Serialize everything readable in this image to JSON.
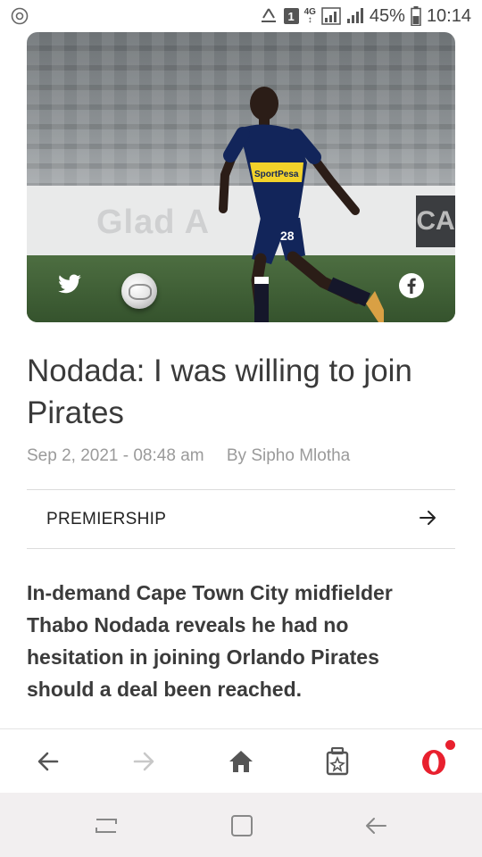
{
  "status_bar": {
    "sim_slot": "1",
    "network": "4G",
    "battery": "45%",
    "time": "10:14"
  },
  "hero": {
    "board_text": "Glad A",
    "board_dark_text": "CA",
    "jersey_sponsor": "SportPesa",
    "jersey_number": "28",
    "icons": [
      "twitter-icon",
      "facebook-icon"
    ]
  },
  "article": {
    "title": "Nodada: I was willing to join Pirates",
    "date": "Sep 2, 2021 - 08:48 am",
    "author": "By Sipho Mlotha",
    "category": "PREMIERSHIP",
    "lead": "In-demand Cape Town City midfielder Thabo Nodada reveals he had no hesitation in joining Orlando Pirates should a deal been reached."
  },
  "toolbar": {
    "opera_logo": "O",
    "icons": [
      "back-icon",
      "forward-icon",
      "home-icon",
      "tabs-icon",
      "opera-menu-icon"
    ],
    "colors": {
      "opera_red": "#e8202e",
      "forward_disabled": "#c8c8c8"
    }
  },
  "navbar": {
    "icons": [
      "recent-apps-icon",
      "home-square-icon",
      "back-nav-icon"
    ]
  }
}
